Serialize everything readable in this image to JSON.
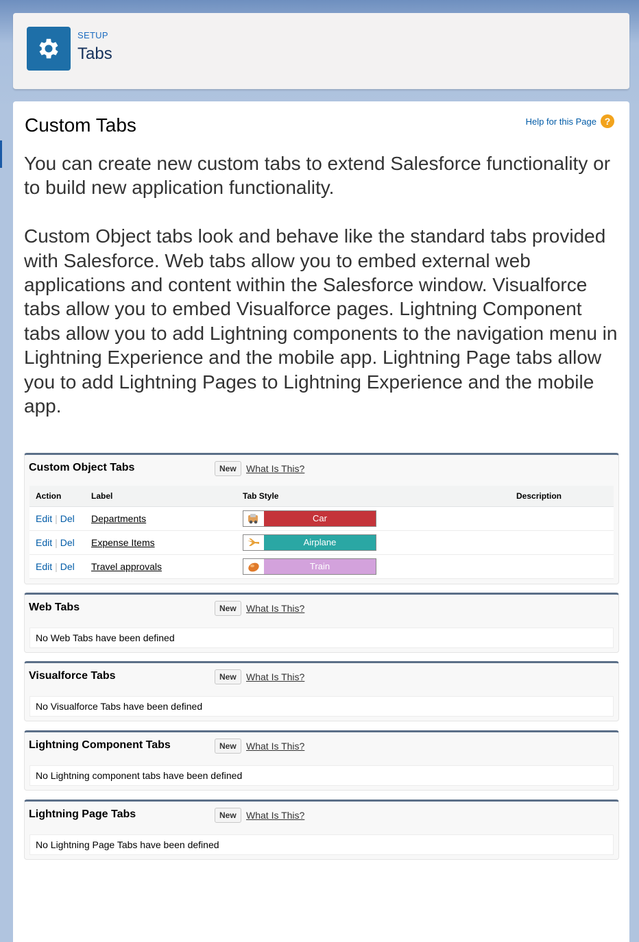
{
  "header": {
    "eyebrow": "SETUP",
    "title": "Tabs",
    "icon": "gear-icon"
  },
  "page": {
    "title": "Custom Tabs",
    "help_link": "Help for this Page",
    "help_icon": "?",
    "intro_1": "You can create new custom tabs to extend Salesforce functionality or to build new application functionality.",
    "intro_2": "Custom Object tabs look and behave like the standard tabs provided with Salesforce. Web tabs allow you to embed external web applications and content within the Salesforce window. Visualforce tabs allow you to embed Visualforce pages. Lightning Component tabs allow you to add Lightning components to the navigation menu in Lightning Experience and the mobile app. Lightning Page tabs allow you to add Lightning Pages to Lightning Experience and the mobile app."
  },
  "custom_object_tabs": {
    "title": "Custom Object Tabs",
    "new_label": "New",
    "what_label": "What Is This?",
    "columns": [
      "Action",
      "Label",
      "Tab Style",
      "Description"
    ],
    "rows": [
      {
        "edit": "Edit",
        "sep": "|",
        "del": "Del",
        "label": "Departments",
        "style": "Car",
        "color": "#c4343a",
        "icon": "car-icon"
      },
      {
        "edit": "Edit",
        "sep": "|",
        "del": "Del",
        "label": "Expense Items",
        "style": "Airplane",
        "color": "#2aa7a4",
        "icon": "airplane-icon"
      },
      {
        "edit": "Edit",
        "sep": "|",
        "del": "Del",
        "label": "Travel approvals",
        "style": "Train",
        "color": "#d3a2dc",
        "icon": "train-icon"
      }
    ]
  },
  "web_tabs": {
    "title": "Web Tabs",
    "new_label": "New",
    "what_label": "What Is This?",
    "empty": "No Web Tabs have been defined"
  },
  "visualforce_tabs": {
    "title": "Visualforce Tabs",
    "new_label": "New",
    "what_label": "What Is This?",
    "empty": "No Visualforce Tabs have been defined"
  },
  "lightning_component_tabs": {
    "title": "Lightning Component Tabs",
    "new_label": "New",
    "what_label": "What Is This?",
    "empty": "No Lightning component tabs have been defined"
  },
  "lightning_page_tabs": {
    "title": "Lightning Page Tabs",
    "new_label": "New",
    "what_label": "What Is This?",
    "empty": "No Lightning Page Tabs have been defined"
  }
}
